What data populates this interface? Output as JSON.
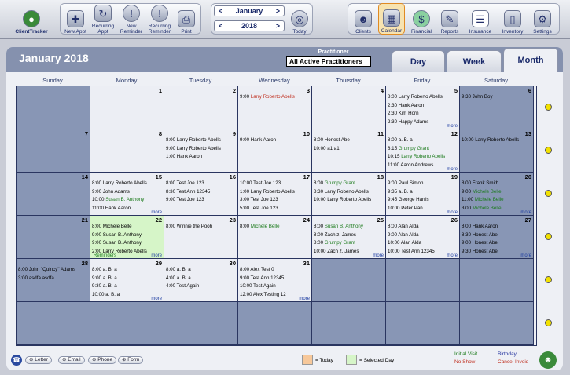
{
  "toolbar": {
    "client_tracker": "ClientTracker",
    "new_appt": "New Appt",
    "recurring_appt": "Recurring Appt",
    "new_reminder": "New Reminder",
    "recurring_reminder": "Recurring Reminder",
    "print": "Print",
    "month_value": "January",
    "year_value": "2018",
    "today": "Today",
    "clients": "Clients",
    "calendar": "Calendar",
    "financial": "Financial",
    "reports": "Reports",
    "insurance": "Insurance",
    "inventory": "Inventory",
    "settings": "Settings"
  },
  "header": {
    "month_title": "January 2018",
    "practitioner_label": "Practitioner",
    "practitioner_value": "All Active Practitioners"
  },
  "tabs": {
    "day": "Day",
    "week": "Week",
    "month": "Month"
  },
  "weekdays": [
    "Sunday",
    "Monday",
    "Tuesday",
    "Wednesday",
    "Thursday",
    "Friday",
    "Saturday"
  ],
  "weeks": [
    [
      {
        "d": ""
      },
      {
        "d": "1"
      },
      {
        "d": "2"
      },
      {
        "d": "3",
        "ev": [
          "9:00 Larry Roberto Abells"
        ]
      },
      {
        "d": "4"
      },
      {
        "d": "5",
        "ev": [
          "8:00 Larry Roberto Abells",
          "2:30 Hank Aaron",
          "2:30 Kim Horn",
          "2:30 Happy Adams"
        ],
        "more": "more"
      },
      {
        "d": "6",
        "ev": [
          "9:30 John Boy"
        ]
      }
    ],
    [
      {
        "d": "7"
      },
      {
        "d": "8"
      },
      {
        "d": "9",
        "ev": [
          "8:00 Larry Roberto Abells",
          "9:00 Larry Roberto Abells",
          "1:00 Hank Aaron"
        ]
      },
      {
        "d": "10",
        "ev": [
          "9:00 Hank Aaron"
        ]
      },
      {
        "d": "11",
        "ev": [
          "8:00 Honest Abe",
          "10:00 a1 a1"
        ]
      },
      {
        "d": "12",
        "ev": [
          "8:00 a. B. a",
          "8:15 Grumpy Grant",
          "10:15 Larry Roberto Abells",
          "11:00 Aaron Andrews"
        ],
        "more": "more"
      },
      {
        "d": "13",
        "ev": [
          "10:00 Larry Roberto Abells"
        ]
      }
    ],
    [
      {
        "d": "14"
      },
      {
        "d": "15",
        "ev": [
          "8:00 Larry Roberto Abells",
          "9:00 John Adams",
          "10:00 Susan B. Anthony",
          "11:00 Hank Aaron"
        ],
        "more": "more"
      },
      {
        "d": "16",
        "ev": [
          "8:00 Test Joe 123",
          "8:30 Test Ann 12345",
          "9:00 Test Joe 123"
        ]
      },
      {
        "d": "17",
        "ev": [
          "10:00 Test Joe 123",
          "1:00 Larry Roberto Abells",
          "3:00 Test Joe 123",
          "5:00 Test Joe 123"
        ]
      },
      {
        "d": "18",
        "ev": [
          "8:00 Grumpy Grant",
          "8:30 Larry Roberto Abells",
          "10:00 Larry Roberto Abells"
        ]
      },
      {
        "d": "19",
        "ev": [
          "9:00 Paul Simon",
          "9:35 a. B. a",
          "9:45 George Harris",
          "10:00 Peter Pan"
        ],
        "more": "more"
      },
      {
        "d": "20",
        "ev": [
          "8:00 Frank Smith",
          "9:00 Michele Belle",
          "11:00 Michele Belle",
          "3:00 Michele Belle"
        ],
        "more": "more"
      }
    ],
    [
      {
        "d": "21"
      },
      {
        "d": "22",
        "ev": [
          "8:00 Michele Belle",
          "9:00 Susan B. Anthony",
          "9:00 Susan B. Anthony",
          "2:00 Larry Roberto Abells"
        ],
        "more": "more",
        "reminders": "Reminders"
      },
      {
        "d": "23",
        "ev": [
          "8:00 Winnie the Pooh"
        ]
      },
      {
        "d": "24",
        "ev": [
          "8:00 Michele Belle"
        ]
      },
      {
        "d": "25",
        "ev": [
          "8:00 Susan B. Anthony",
          "8:00 Zach z. James",
          "8:00 Grumpy Grant",
          "10:00 Zach z. James"
        ],
        "more": "more"
      },
      {
        "d": "26",
        "ev": [
          "8:00 Alan Alda",
          "9:00 Alan Alda",
          "10:00 Alan Alda",
          "10:00 Test Ann 12345"
        ],
        "more": "more"
      },
      {
        "d": "27",
        "ev": [
          "8:00 Hank Aaron",
          "8:30 Honest Abe",
          "9:00 Honest Abe",
          "9:30 Honest Abe"
        ],
        "more": "more"
      }
    ],
    [
      {
        "d": "28",
        "ev": [
          "8:00 John \"Quincy\" Adams",
          "3:00 asdfa asdfa"
        ]
      },
      {
        "d": "29",
        "ev": [
          "8:00 a. B. a",
          "9:00 a. B. a",
          "9:30 a. B. a",
          "10:00 a. B. a"
        ],
        "more": "more"
      },
      {
        "d": "30",
        "ev": [
          "8:00 a. B. a",
          "4:00 a. B. a",
          "4:00 Test Again"
        ]
      },
      {
        "d": "31",
        "ev": [
          "8:00 Alex Test 0",
          "9:00 Test Ann 12345",
          "10:00 Test Again",
          "12:00 Alex Testing 12"
        ],
        "more": "more"
      },
      {
        "d": ""
      },
      {
        "d": ""
      },
      {
        "d": ""
      }
    ],
    [
      {
        "d": ""
      },
      {
        "d": ""
      },
      {
        "d": ""
      },
      {
        "d": ""
      },
      {
        "d": ""
      },
      {
        "d": ""
      },
      {
        "d": ""
      }
    ]
  ],
  "footer": {
    "letter": "Letter",
    "email": "Email",
    "phone": "Phone",
    "form": "Form",
    "today_legend": "= Today",
    "selected_legend": "= Selected Day",
    "initial_visit": "Initial Visit",
    "birthday": "Birthday",
    "no_show": "No Show",
    "cancel_invoid": "Cancel Invoid"
  },
  "colors": {
    "today": "#f7c89a",
    "selected": "#d6f5c8",
    "green_text": "#1a7a1a",
    "red_text": "#c03020",
    "weekend": "#8896b5"
  }
}
